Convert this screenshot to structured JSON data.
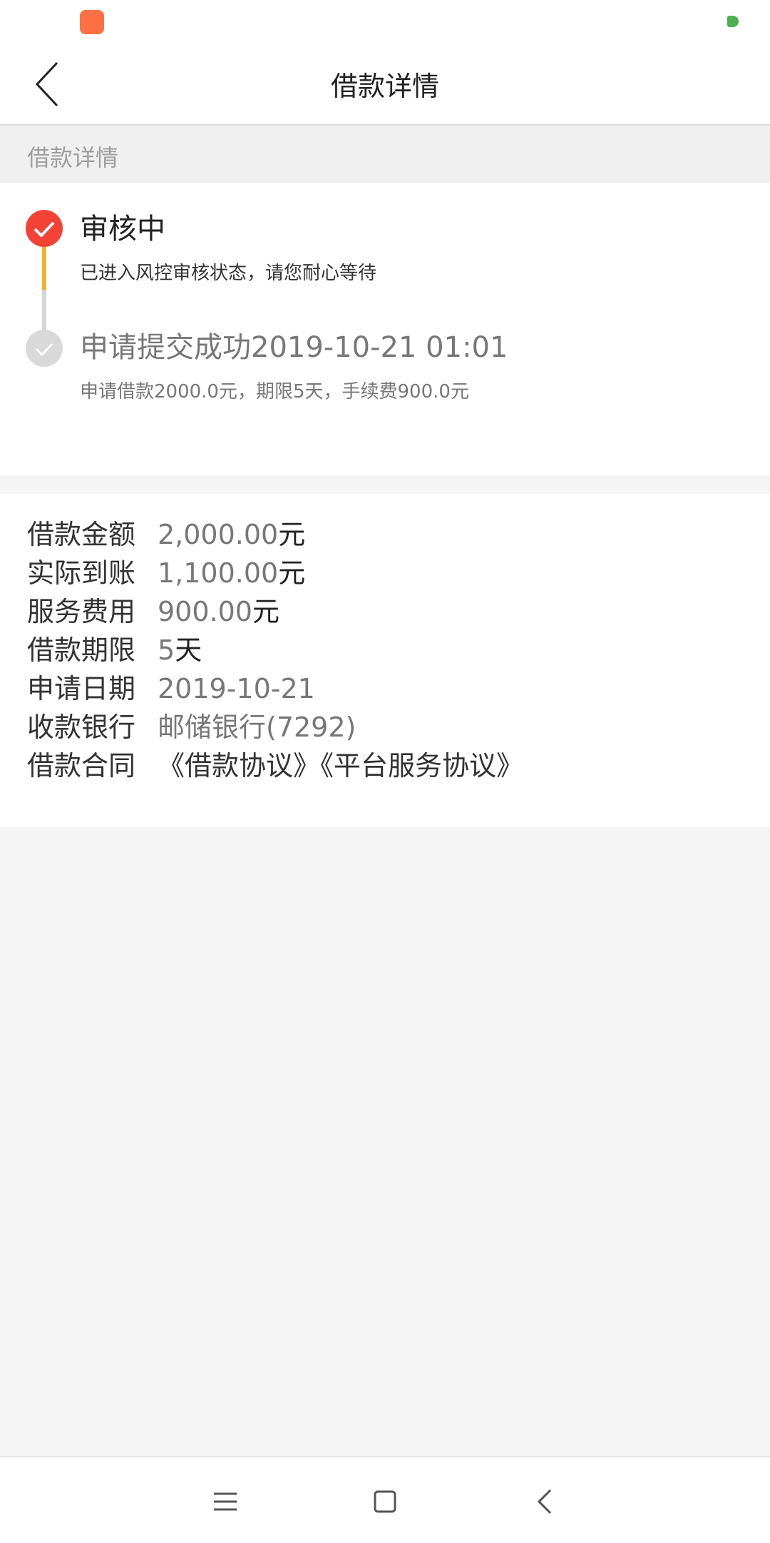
{
  "header": {
    "title": "借款详情"
  },
  "section": {
    "title": "借款详情"
  },
  "timeline": [
    {
      "title": "审核中",
      "desc": "已进入风控审核状态，请您耐心等待"
    },
    {
      "title": "申请提交成功2019-10-21 01:01",
      "desc": "申请借款2000.0元，期限5天，手续费900.0元"
    }
  ],
  "details": {
    "amount": {
      "label": "借款金额",
      "value": "2,000.00",
      "unit": "元"
    },
    "received": {
      "label": "实际到账",
      "value": "1,100.00",
      "unit": "元"
    },
    "fee": {
      "label": "服务费用",
      "value": "900.00",
      "unit": "元"
    },
    "term": {
      "label": "借款期限",
      "value": "5",
      "unit": "天"
    },
    "date": {
      "label": "申请日期",
      "value": "2019-10-21"
    },
    "bank": {
      "label": "收款银行",
      "value": "邮储银行(7292)"
    },
    "contract": {
      "label": "借款合同",
      "link1": "《借款协议》",
      "link2": "《平台服务协议》"
    }
  },
  "colors": {
    "accent": "#f44336",
    "timeline_line": "#f0b132",
    "inactive": "#d9d9d9"
  }
}
